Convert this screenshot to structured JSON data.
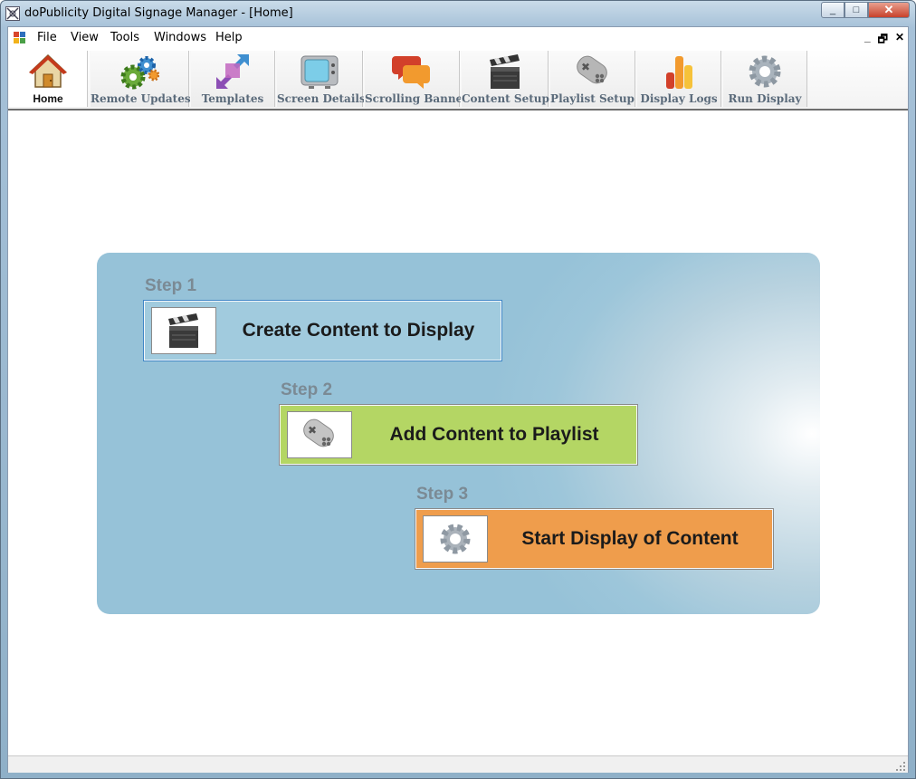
{
  "window": {
    "title": "doPublicity Digital Signage Manager - [Home]",
    "controls": {
      "minimize": "_",
      "maximize": "□",
      "close": "✕"
    }
  },
  "menu": {
    "items": [
      "File",
      "View",
      "Tools",
      "Windows",
      "Help"
    ],
    "mdi": {
      "minimize": "_",
      "restore": "🗗",
      "close": "✕"
    }
  },
  "toolbar": {
    "items": [
      {
        "label": "Home",
        "icon": "house-icon",
        "active": true
      },
      {
        "label": "Remote Updates",
        "icon": "gears-icon",
        "active": false
      },
      {
        "label": "Templates",
        "icon": "arrows-icon",
        "active": false
      },
      {
        "label": "Screen Details",
        "icon": "tv-icon",
        "active": false
      },
      {
        "label": "Scrolling Banner",
        "icon": "chat-bubbles-icon",
        "active": false
      },
      {
        "label": "Content Setup",
        "icon": "clapperboard-icon",
        "active": false
      },
      {
        "label": "Playlist Setup",
        "icon": "gamepad-icon",
        "active": false
      },
      {
        "label": "Display Logs",
        "icon": "bar-chart-icon",
        "active": false
      },
      {
        "label": "Run Display",
        "icon": "gear-icon",
        "active": false
      }
    ]
  },
  "steps": [
    {
      "step": "Step 1",
      "button": "Create Content to Display",
      "icon": "clapperboard-icon",
      "color": "#a1cbde"
    },
    {
      "step": "Step 2",
      "button": "Add Content to Playlist",
      "icon": "gamepad-icon",
      "color": "#b4d664"
    },
    {
      "step": "Step 3",
      "button": "Start Display of Content",
      "icon": "gear-icon",
      "color": "#ef9d4c"
    }
  ]
}
